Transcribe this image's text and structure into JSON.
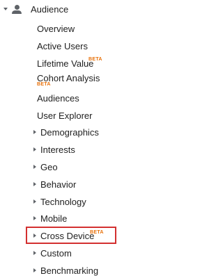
{
  "section": {
    "label": "Audience",
    "icon": "person-icon",
    "expand_icon": "caret-down-icon"
  },
  "leaf_items": [
    {
      "label": "Overview"
    },
    {
      "label": "Active Users"
    },
    {
      "label": "Lifetime Value",
      "badge": "BETA"
    },
    {
      "label": "Cohort Analysis",
      "badge": "BETA"
    },
    {
      "label": "Audiences"
    },
    {
      "label": "User Explorer"
    }
  ],
  "group_items": [
    {
      "label": "Demographics"
    },
    {
      "label": "Interests"
    },
    {
      "label": "Geo"
    },
    {
      "label": "Behavior"
    },
    {
      "label": "Technology"
    },
    {
      "label": "Mobile"
    },
    {
      "label": "Cross Device",
      "badge": "BETA",
      "highlighted": true
    },
    {
      "label": "Custom"
    },
    {
      "label": "Benchmarking"
    }
  ],
  "colors": {
    "badge": "#e8710a",
    "highlight_border": "#d32f2f",
    "icon": "#5f6368",
    "text": "#212121"
  }
}
